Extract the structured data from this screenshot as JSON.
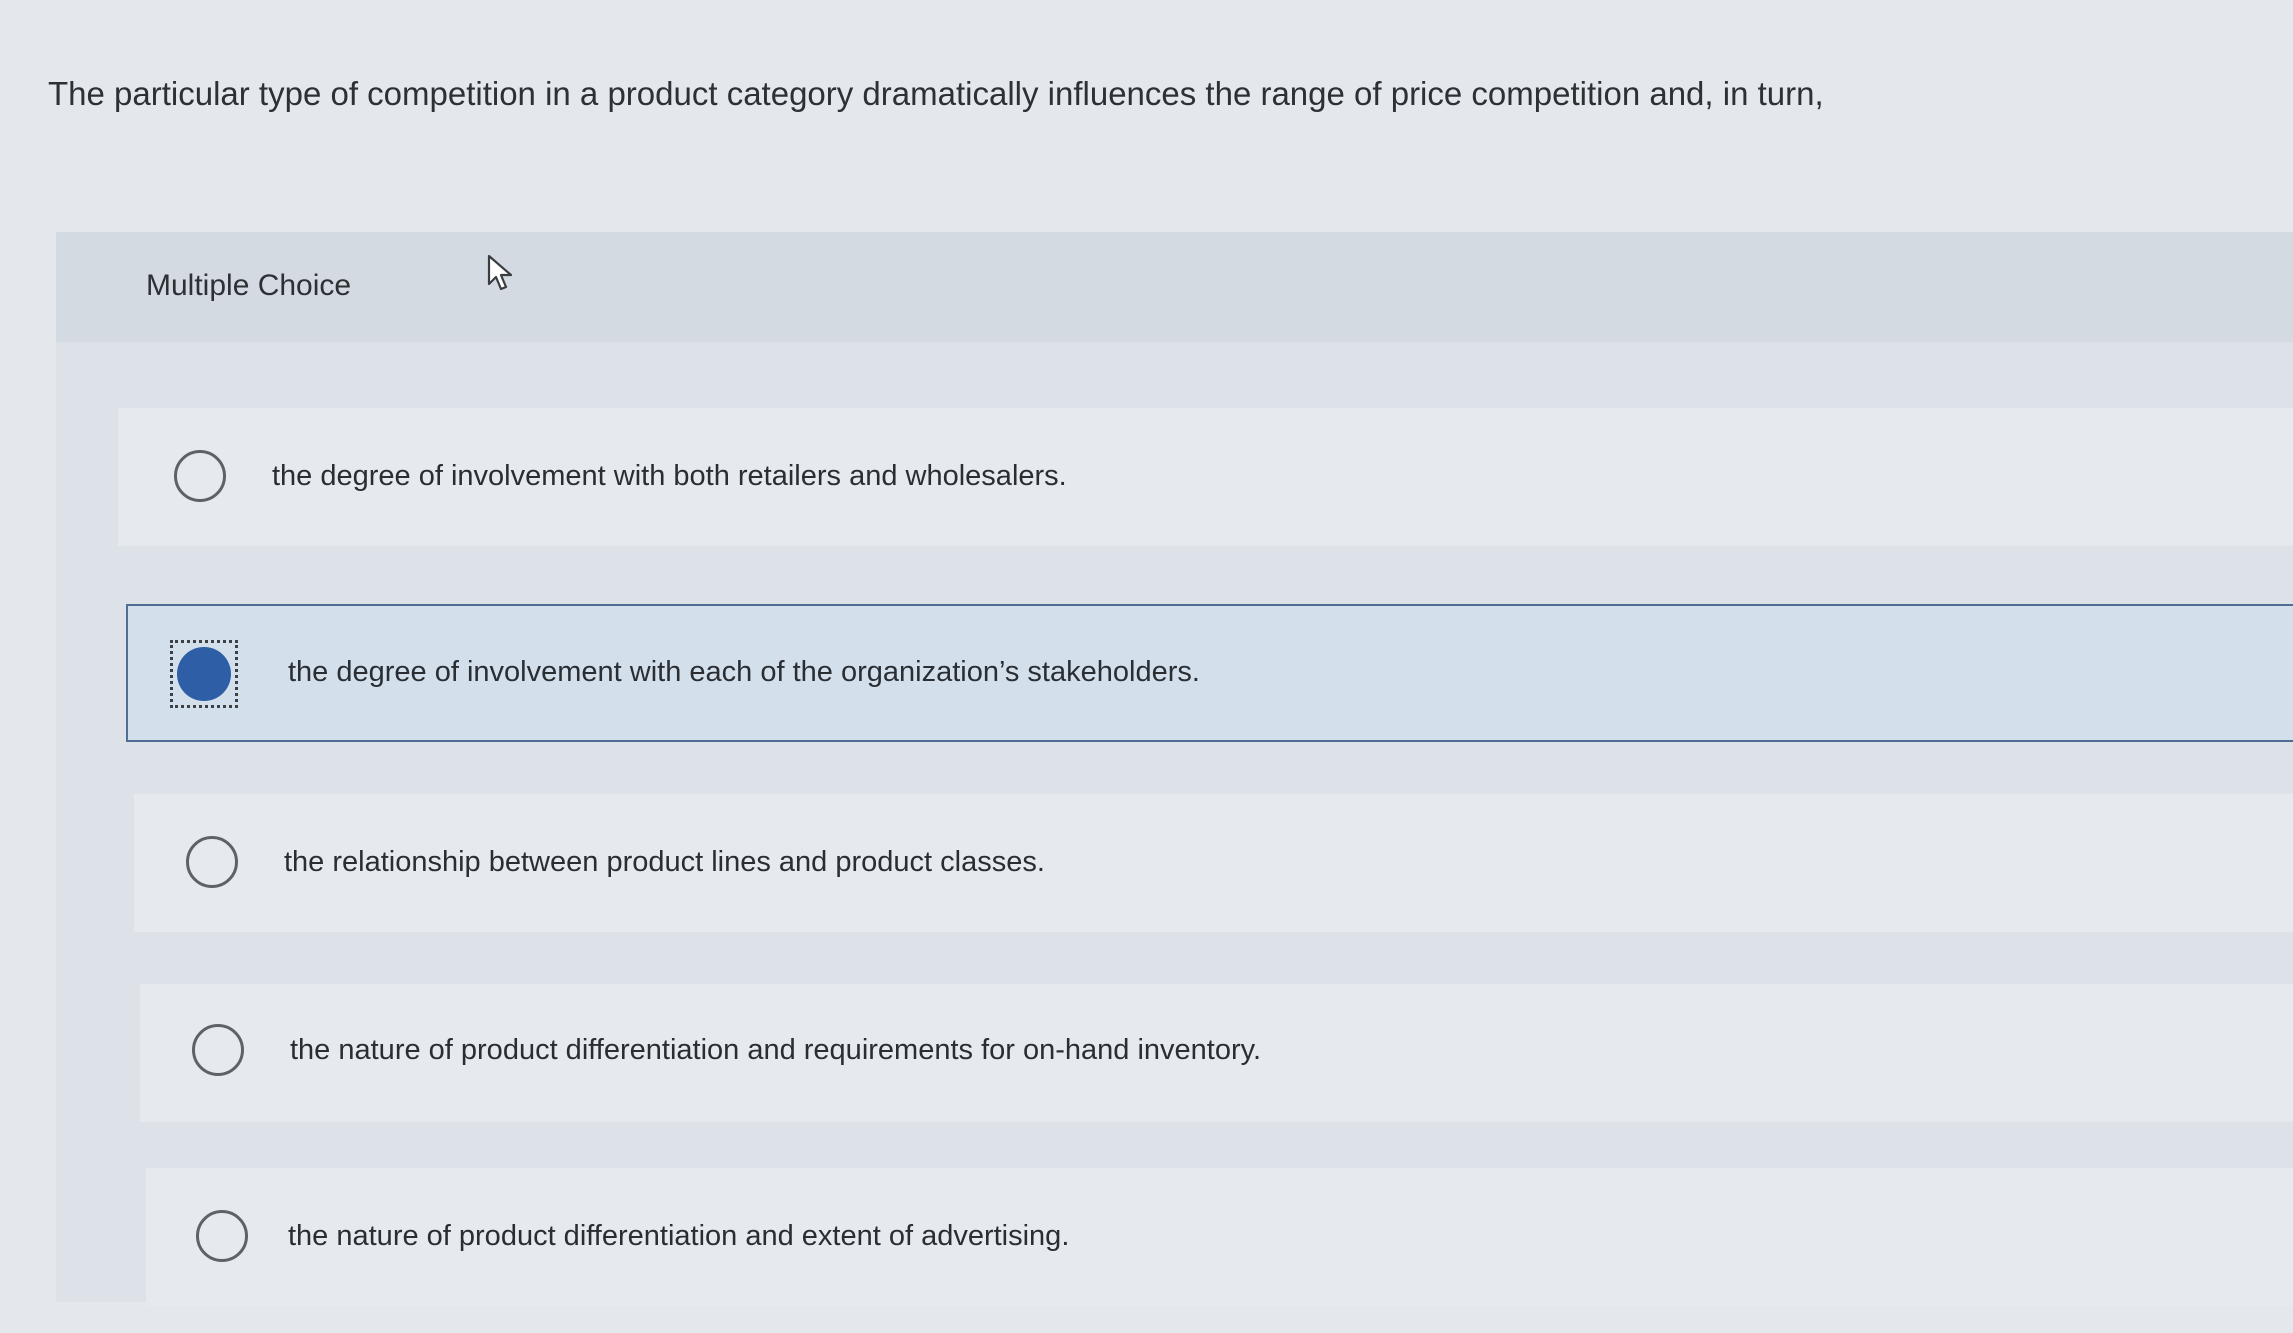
{
  "question": {
    "text": "The particular type of competition in a product category dramatically influences the range of price competition and, in turn,"
  },
  "quiz": {
    "type_label": "Multiple Choice",
    "selected_index": 1,
    "options": [
      {
        "text": "the degree of involvement with both retailers and wholesalers.",
        "selected": false
      },
      {
        "text": "the degree of involvement with each of the organization’s stakeholders.",
        "selected": true
      },
      {
        "text": "the relationship between product lines and product classes.",
        "selected": false
      },
      {
        "text": "the nature of product differentiation and requirements for on-hand inventory.",
        "selected": false
      },
      {
        "text": "the nature of product differentiation and extent of advertising.",
        "selected": false
      }
    ]
  },
  "colors": {
    "selected_fill": "#2d5ea6",
    "selected_background": "#d3e0ec",
    "selected_border": "#4f6e93"
  },
  "icons": {
    "cursor": "mouse-pointer-arrow",
    "radio_unselected": "empty-circle",
    "radio_selected": "filled-circle"
  }
}
